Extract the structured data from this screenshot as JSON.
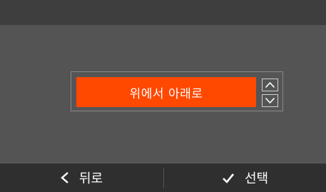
{
  "setting": {
    "value": "위에서 아래로"
  },
  "softkeys": {
    "back_label": "뒤로",
    "select_label": "선택"
  },
  "icons": {
    "up": "chevron-up-icon",
    "down": "chevron-down-icon",
    "back": "chevron-left-icon",
    "select": "checkmark-icon"
  },
  "colors": {
    "accent": "#ff4800",
    "background": "#545454",
    "top_bar": "#3e3e3e",
    "bottom_bar": "#2f2f2f"
  }
}
